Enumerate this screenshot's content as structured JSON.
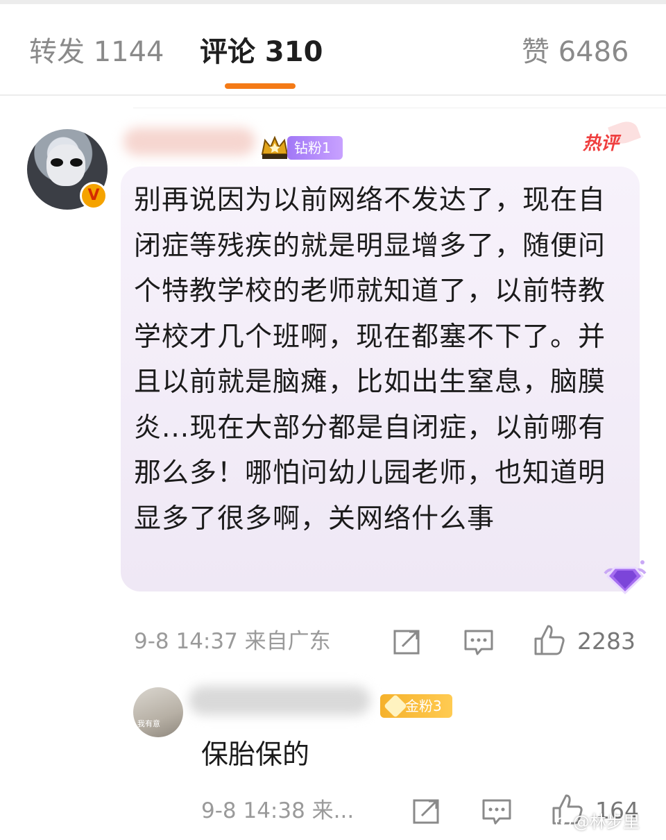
{
  "tabs": [
    {
      "label": "转发 1144"
    },
    {
      "label": "评论 310",
      "active": true
    },
    {
      "label": "赞 6486"
    }
  ],
  "accent_color": "#f47a16",
  "comment": {
    "fan_badge": "钻粉1",
    "hot_tag": "热评",
    "verify_badge": "V",
    "text": "别再说因为以前网络不发达了，现在自闭症等残疾的就是明显增多了，随便问个特教学校的老师就知道了，以前特教学校才几个班啊，现在都塞不下了。并且以前就是脑瘫，比如出生窒息，脑膜炎...现在大部分都是自闭症，以前哪有那么多！哪怕问幼儿园老师，也知道明显多了很多啊，关网络什么事",
    "time_location": "9-8 14:37 来自广东",
    "likes": "2283"
  },
  "reply": {
    "avatar_text": "我有意",
    "fan_badge": "金粉3",
    "text": "保胎保的",
    "time_location": "9-8 14:38 来...",
    "likes": "164"
  },
  "watermark": "@林步里"
}
